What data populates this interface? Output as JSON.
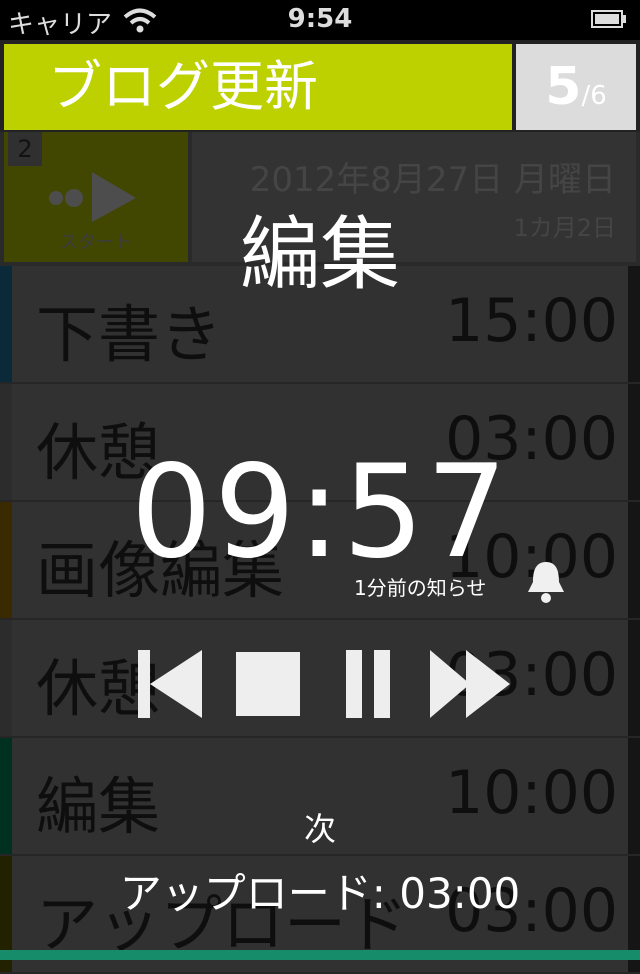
{
  "status_bar": {
    "carrier": "キャリア",
    "time": "9:54"
  },
  "header": {
    "title": "ブログ更新",
    "current": "5",
    "total": "/6"
  },
  "start_card": {
    "number": "2",
    "label": "スタート"
  },
  "date_card": {
    "date": "2012年8月27日 月曜日",
    "relative": "1カ月2日"
  },
  "tasks": [
    {
      "name": "下書き",
      "duration": "15:00",
      "color": "#0a2a3a"
    },
    {
      "name": "休憩",
      "duration": "03:00",
      "color": "#2c2c2c"
    },
    {
      "name": "画像編集",
      "duration": "10:00",
      "color": "#3a2a00"
    },
    {
      "name": "休憩",
      "duration": "03:00",
      "color": "#2c2c2c"
    },
    {
      "name": "編集",
      "duration": "10:00",
      "color": "#003020"
    },
    {
      "name": "アップロード",
      "duration": "03:00",
      "color": "#222200"
    }
  ],
  "current_task": {
    "title": "編集",
    "remaining": "09:57",
    "notice": "1分前の知らせ"
  },
  "next": {
    "label": "次",
    "task": "アップロード: 03:00"
  },
  "icons": {
    "wifi": "wifi-icon",
    "battery": "battery-icon",
    "bell": "bell-icon",
    "prev": "skip-back-icon",
    "stop": "stop-icon",
    "pause": "pause-icon",
    "next": "fast-forward-icon",
    "start": "play-icon"
  },
  "colors": {
    "title_bg": "#bdd000",
    "count_bg": "#dcdcdc",
    "bottom_strip": "#168c6a"
  }
}
